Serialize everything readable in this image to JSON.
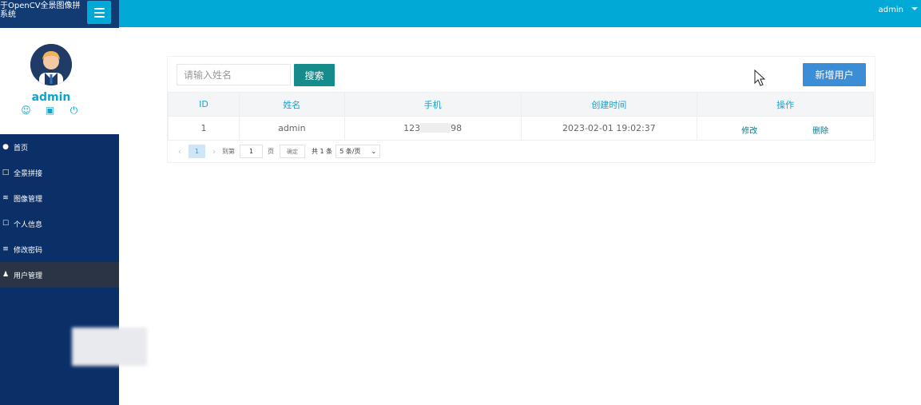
{
  "header": {
    "user": "admin"
  },
  "sidebar": {
    "app_title": "于OpenCV全景图像拼系统",
    "profile_name": "admin",
    "profile_icons": [
      "user-icon",
      "lock-icon",
      "power-icon"
    ],
    "items": [
      {
        "label": "首页",
        "icon": "home-icon"
      },
      {
        "label": "全景拼接",
        "icon": "stitch-icon"
      },
      {
        "label": "图像管理",
        "icon": "image-icon"
      },
      {
        "label": "个人信息",
        "icon": "profile-icon"
      },
      {
        "label": "修改密码",
        "icon": "password-icon"
      },
      {
        "label": "用户管理",
        "icon": "users-icon",
        "active": true
      }
    ]
  },
  "search": {
    "placeholder": "请输入姓名",
    "button_label": "搜索"
  },
  "actions": {
    "add_user_label": "新增用户"
  },
  "table": {
    "headers": [
      "ID",
      "姓名",
      "手机",
      "创建时间",
      "操作"
    ],
    "rows": [
      {
        "id": "1",
        "name": "admin",
        "phone_prefix": "123",
        "phone_suffix": "98",
        "created": "2023-02-01 19:02:37",
        "edit": "修改",
        "delete": "删除"
      }
    ]
  },
  "pagination": {
    "current_page": "1",
    "goto_label": "到第",
    "goto_value": "1",
    "page_label": "页",
    "confirm_label": "确定",
    "total_label": "共 1 条",
    "page_size": "5 条/页"
  },
  "colors": {
    "header": "#00a9d6",
    "sidebar": "#0b2f67",
    "primary": "#168b8b",
    "add_button": "#3b8dd5"
  }
}
